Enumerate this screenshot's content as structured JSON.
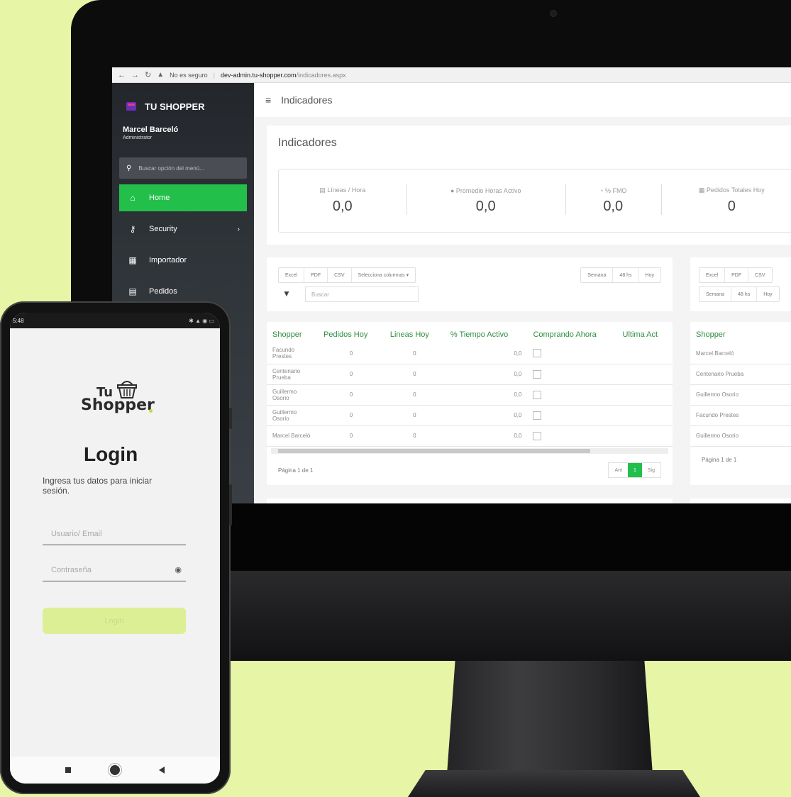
{
  "browser": {
    "warning": "No es seguro",
    "domain": "dev-admin.tu-shopper.com",
    "path": "/indicadores.aspx"
  },
  "sidebar": {
    "brand": "TU SHOPPER",
    "user_name": "Marcel Barceló",
    "user_role": "Administrator",
    "search_placeholder": "Buscar opción del menú...",
    "items": [
      {
        "label": "Home",
        "icon": "home-icon"
      },
      {
        "label": "Security",
        "icon": "key-icon"
      },
      {
        "label": "Importador",
        "icon": "upload-icon"
      },
      {
        "label": "Pedidos",
        "icon": "clipboard-icon"
      }
    ]
  },
  "header": {
    "title": "Indicadores"
  },
  "kpis": {
    "title": "Indicadores",
    "items": [
      {
        "label": "Líneas / Hora",
        "value": "0,0"
      },
      {
        "label": "Promedio Horas Activo",
        "value": "0,0"
      },
      {
        "label": "% FMO",
        "value": "0,0"
      },
      {
        "label": "Pedidos Totales Hoy",
        "value": "0"
      }
    ]
  },
  "panel1": {
    "export_buttons": [
      "Excel",
      "PDF",
      "CSV",
      "Selecciona columnas ▾"
    ],
    "range_buttons": [
      "Semana",
      "48 hs",
      "Hoy"
    ],
    "search_placeholder": "Buscar",
    "columns": [
      "Shopper",
      "Pedidos Hoy",
      "Lineas Hoy",
      "% Tiempo Activo",
      "Comprando Ahora",
      "Ultima Act"
    ],
    "rows": [
      {
        "shopper": "Facundo Prestes",
        "pedidos": "0",
        "lineas": "0",
        "pct": "0,0"
      },
      {
        "shopper": "Centenario Prueba",
        "pedidos": "0",
        "lineas": "0",
        "pct": "0,0"
      },
      {
        "shopper": "Guillermo Osorio",
        "pedidos": "0",
        "lineas": "0",
        "pct": "0,0"
      },
      {
        "shopper": "Guillermo Osorio",
        "pedidos": "0",
        "lineas": "0",
        "pct": "0,0"
      },
      {
        "shopper": "Marcel Barceló",
        "pedidos": "0",
        "lineas": "0",
        "pct": "0,0"
      }
    ],
    "page_info": "Página 1 de 1",
    "pager": [
      "Ant",
      "1",
      "Sig"
    ]
  },
  "panel2": {
    "export_buttons": [
      "Excel",
      "PDF",
      "CSV"
    ],
    "range_buttons": [
      "Semana",
      "48 hs",
      "Hoy"
    ],
    "column": "Shopper",
    "rows": [
      "Marcel Barceló",
      "Centenario Prueba",
      "Guillermo Osorio",
      "Facundo Prestes",
      "Guillermo Osorio"
    ],
    "page_info": "Página 1 de 1"
  },
  "phone": {
    "time": "5:48",
    "logo_tu": "Tu",
    "logo_shopper": "Shopper",
    "title": "Login",
    "subtitle": "Ingresa tus datos para iniciar sesión.",
    "user_placeholder": "Usuario/ Email",
    "password_placeholder": "Contraseña",
    "button": "Login"
  },
  "colors": {
    "accent": "#22c04b",
    "background": "#e6f5a6",
    "header_text": "#2f8e3f"
  }
}
